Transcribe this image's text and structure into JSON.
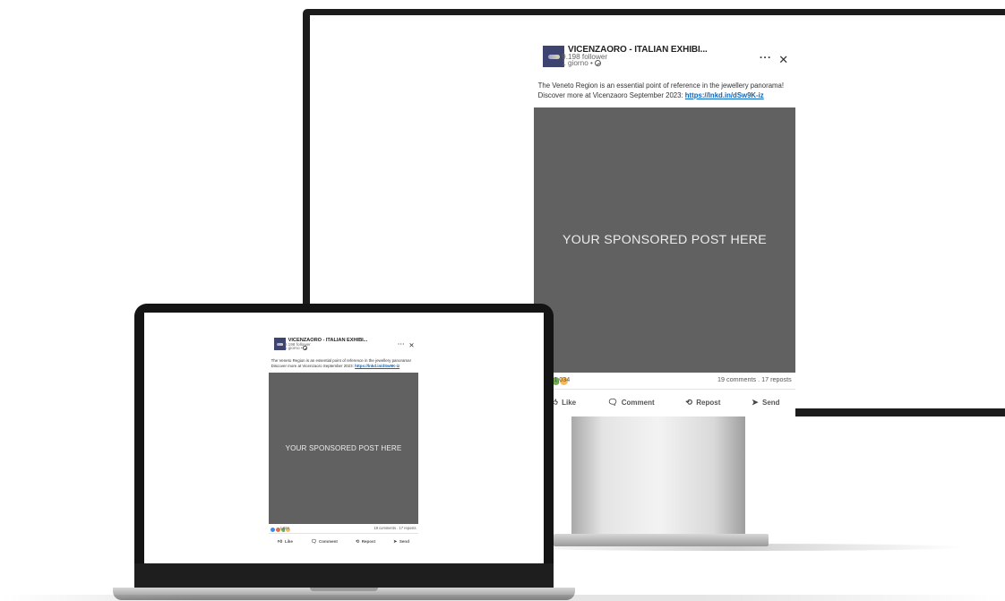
{
  "post": {
    "company_name": "VICENZAORO - ITALIAN EXHIBI...",
    "followers": "9.198 follower",
    "time": "1 giorno •",
    "more_icon": "more-icon",
    "close_icon": "close-icon",
    "text_line1": "The Veneto Region is an essential point of reference in the jewellery panorama!",
    "text_line2_prefix": "Discover more at Vicenzaoro September 2023: ",
    "link": "https://lnkd.in/dSw9K-iz",
    "image_placeholder": "YOUR SPONSORED POST HERE",
    "reactions_count": "1,034",
    "reactions_colors": [
      "#378fe9",
      "#df704d",
      "#6dae4f",
      "#f5bb5c"
    ],
    "comments_reposts": "19 comments . 17 reposts",
    "actions": [
      {
        "label": "Like",
        "icon": "like-icon"
      },
      {
        "label": "Comment",
        "icon": "comment-icon"
      },
      {
        "label": "Repost",
        "icon": "repost-icon"
      },
      {
        "label": "Send",
        "icon": "send-icon"
      }
    ],
    "accent_color": "#0a66c2",
    "image_color": "#616161"
  },
  "post_small": {
    "reactions_count": "1,034",
    "comments_reposts": "19 comments . 17 reposts"
  }
}
